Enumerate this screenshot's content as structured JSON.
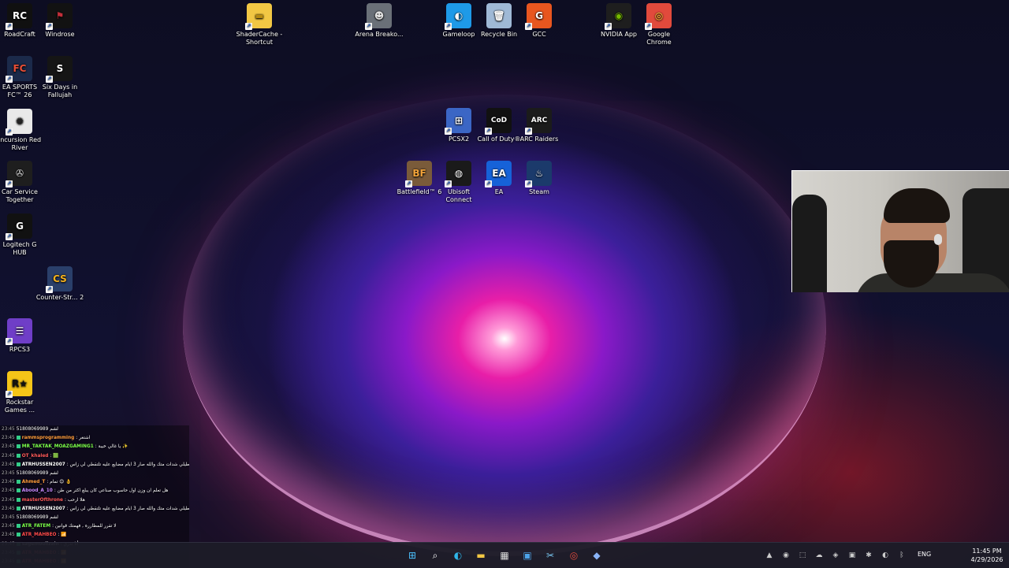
{
  "desktop_icons": [
    {
      "label": "RoadCraft",
      "glyph": "RC",
      "bg": "#101010",
      "fg": "#ffffff"
    },
    {
      "label": "Windrose",
      "glyph": "⚑",
      "bg": "#121212",
      "fg": "#c12f3a"
    },
    {
      "label": "ShaderCache - Shortcut",
      "glyph": "▬",
      "bg": "#f2c744",
      "fg": "#b78a10"
    },
    {
      "label": "Arena Breako...",
      "glyph": "☻",
      "bg": "#6a7078",
      "fg": "#e0e0e0"
    },
    {
      "label": "Gameloop",
      "glyph": "◐",
      "bg": "#1e9ae8",
      "fg": "#ffffff"
    },
    {
      "label": "Recycle Bin",
      "glyph": "🗑",
      "bg": "#9fb9d6",
      "fg": "#ffffff"
    },
    {
      "label": "GCC",
      "glyph": "G",
      "bg": "#e8561f",
      "fg": "#ffffff"
    },
    {
      "label": "NVIDIA App",
      "glyph": "◉",
      "bg": "#1e1e1e",
      "fg": "#76b900"
    },
    {
      "label": "Google Chrome",
      "glyph": "◎",
      "bg": "#e14a3c",
      "fg": "#fdd835"
    },
    {
      "label": "EA SPORTS FC™ 26",
      "glyph": "FC",
      "bg": "#1b2a4a",
      "fg": "#e94f37"
    },
    {
      "label": "Six Days in Fallujah",
      "glyph": "S",
      "bg": "#151515",
      "fg": "#ffffff"
    },
    {
      "label": "PCSX2",
      "glyph": "⊞",
      "bg": "#3b66c5",
      "fg": "#ffffff"
    },
    {
      "label": "Call of Duty®",
      "glyph": "CoD",
      "bg": "#111111",
      "fg": "#ffffff"
    },
    {
      "label": "ARC Raiders",
      "glyph": "ARC",
      "bg": "#1b1b1b",
      "fg": "#ffffff"
    },
    {
      "label": "Incursion Red River",
      "glyph": "✺",
      "bg": "#e9e9e9",
      "fg": "#222222"
    },
    {
      "label": "Battlefield™ 6",
      "glyph": "BF",
      "bg": "#7a5b3a",
      "fg": "#f2a33a"
    },
    {
      "label": "Ubisoft Connect",
      "glyph": "◍",
      "bg": "#1a1a1a",
      "fg": "#ffffff"
    },
    {
      "label": "EA",
      "glyph": "EA",
      "bg": "#1662d8",
      "fg": "#ffffff"
    },
    {
      "label": "Steam",
      "glyph": "♨",
      "bg": "#1b3a6b",
      "fg": "#ffffff"
    },
    {
      "label": "Car Service Together",
      "glyph": "✇",
      "bg": "#1e1e1e",
      "fg": "#dddddd"
    },
    {
      "label": "Logitech G HUB",
      "glyph": "G",
      "bg": "#111111",
      "fg": "#ffffff"
    },
    {
      "label": "Counter-Str... 2",
      "glyph": "CS",
      "bg": "#2a3f6a",
      "fg": "#f5b21f"
    },
    {
      "label": "RPCS3",
      "glyph": "☰",
      "bg": "#6f3ec7",
      "fg": "#ffffff"
    },
    {
      "label": "Rockstar Games ...",
      "glyph": "R★",
      "bg": "#f5c518",
      "fg": "#111111"
    }
  ],
  "chat": [
    {
      "time": "23:45",
      "user": "",
      "text": "51808069989 لشم",
      "color": "#ffffff"
    },
    {
      "time": "23:45",
      "user": "rammsprogramming",
      "text": ": اشتغر",
      "color": "#ff9c3b"
    },
    {
      "time": "23:45",
      "user": "MR_TAKTAK_MOAZGAMING1",
      "text": ": يا غالي خيبة ✨",
      "color": "#7cff4a"
    },
    {
      "time": "23:45",
      "user": "OT_khaled",
      "text": ": 🟩",
      "color": "#ff5a5a"
    },
    {
      "time": "23:45",
      "user": "ATRHUSSEN2007",
      "text": ": زين الطيلي شدات متك والله صار 3 ايام مضايع عليه تلتقطي لي زاس",
      "color": "#ffffff"
    },
    {
      "time": "23:45",
      "user": "",
      "text": "51808069989 لشم",
      "color": "#ffffff"
    },
    {
      "time": "23:45",
      "user": "Ahmed_T",
      "text": ": تمام 😊 👌",
      "color": "#ff9c3b"
    },
    {
      "time": "23:45",
      "user": "Abood_A_10",
      "text": ": هل تعلم ان وزن اول حاسوب صناعي كان يبلغ اكثر من طن",
      "color": "#c78aff"
    },
    {
      "time": "23:45",
      "user": "masterOfthrone",
      "text": ": هلا ارحب",
      "color": "#ff5a5a"
    },
    {
      "time": "23:45",
      "user": "ATRHUSSEN2007",
      "text": ": زين الطيلي شدات متك والله صار 3 ايام مضايع عليه تلتقطي لي زاس",
      "color": "#ffffff"
    },
    {
      "time": "23:45",
      "user": "",
      "text": "51808069989 لشم",
      "color": "#ffffff"
    },
    {
      "time": "23:45",
      "user": "ATR_FATEM",
      "text": ": لا تقرر للمطاررة , فهمتك قوانين",
      "color": "#7cff4a"
    },
    {
      "time": "23:45",
      "user": "ATR_MAHBEO",
      "text": ": 📶",
      "color": "#ff4a4a"
    },
    {
      "time": "23:45",
      "user": "sagemoullzain",
      "text": ": أنا تذري",
      "color": "#ffffff"
    },
    {
      "time": "23:45",
      "user": "ATR_MAHBEO",
      "text": ": 📶",
      "color": "#ff4a4a"
    },
    {
      "time": "23:45",
      "user": "ATR_MAHBEO",
      "text": ": 📶",
      "color": "#ff4a4a"
    }
  ],
  "taskbar": {
    "apps": [
      {
        "name": "start",
        "glyph": "⊞",
        "color": "#4cc2ff"
      },
      {
        "name": "search",
        "glyph": "⌕",
        "color": "#ffffff"
      },
      {
        "name": "edge",
        "glyph": "◐",
        "color": "#2fb5e8"
      },
      {
        "name": "file-explorer",
        "glyph": "▬",
        "color": "#f2c744"
      },
      {
        "name": "store",
        "glyph": "▦",
        "color": "#dddddd"
      },
      {
        "name": "photos",
        "glyph": "▣",
        "color": "#4da3e8"
      },
      {
        "name": "snipping",
        "glyph": "✂",
        "color": "#7ac7f0"
      },
      {
        "name": "chrome",
        "glyph": "◎",
        "color": "#e14a3c"
      },
      {
        "name": "vpn",
        "glyph": "◆",
        "color": "#8ab4f8"
      }
    ],
    "tray": [
      "▲",
      "◉",
      "⬚",
      "☁",
      "◈",
      "▣",
      "✱",
      "◐",
      "ᛒ"
    ],
    "language": "ENG",
    "time": "11:45 PM",
    "date": "4/29/2026"
  }
}
